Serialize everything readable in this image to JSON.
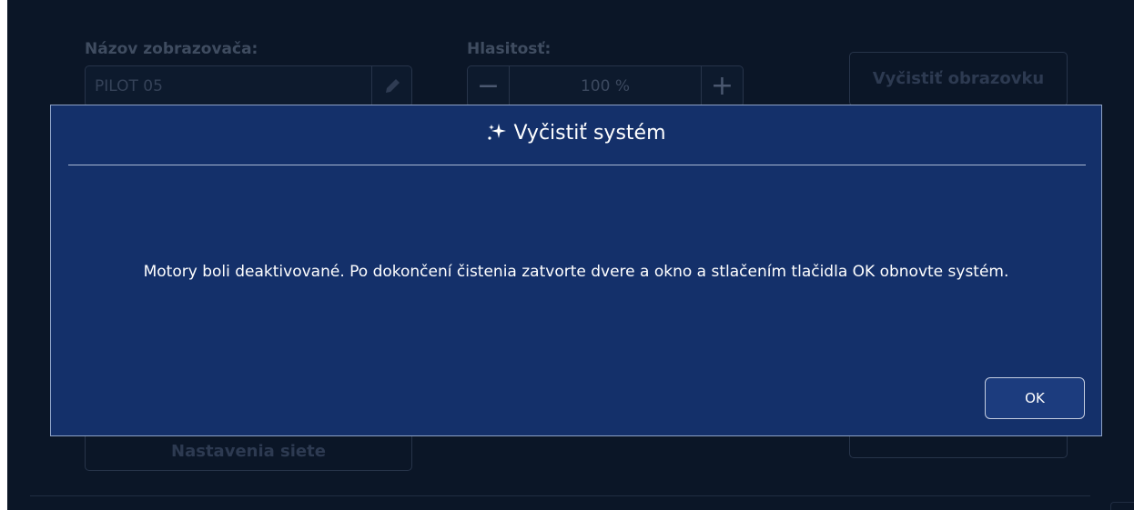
{
  "background": {
    "display_name_label": "Názov zobrazovača:",
    "display_name_value": "PILOT 05",
    "volume_label": "Hlasitosť:",
    "volume_value": "100 %",
    "volume_decrease": "−",
    "volume_increase": "+",
    "clean_screen_button": "Vyčistiť obrazovku",
    "network_settings_button": "Nastavenia siete"
  },
  "dialog": {
    "title": "Vyčistiť systém",
    "title_icon": "sparkles-icon",
    "message": "Motory boli deaktivované. Po dokončení čistenia zatvorte dvere a okno a stlačením tlačidla OK obnovte systém.",
    "ok_button": "OK"
  },
  "colors": {
    "app_background": "#0b1627",
    "dialog_background": "#14306a",
    "dialog_border": "#8ea2c6",
    "text": "#ffffff"
  }
}
